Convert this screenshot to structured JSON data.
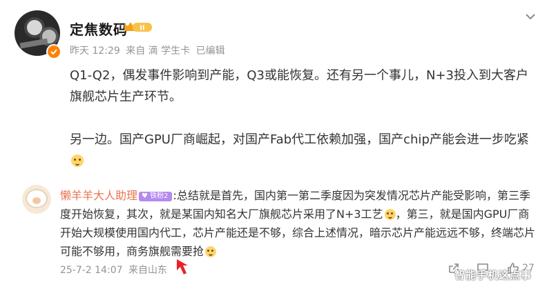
{
  "post": {
    "author": "定焦数码",
    "vip_label": "II",
    "meta": {
      "time": "昨天 12:29",
      "source": "来自 滴 学生卡",
      "edited": "已编辑"
    },
    "paragraphs": [
      "Q1-Q2，偶发事件影响到产能，Q3或能恢复。还有另一个事儿，N+3投入到大客户旗舰芯片生产环节。",
      "另一边。国产GPU厂商崛起，对国产Fab代工依赖加强，国产chip产能会进一步吃紧"
    ],
    "emoji_name": "doge-emoji"
  },
  "comment": {
    "author": "懒羊羊大人助理",
    "fan_badge": "铁粉2",
    "text_part1": ":总结就是首先，国内第一第二季度因为突发情况芯片产能受影响，第三季度开始恢复，其次，就是某国内知名大厂旗舰芯片采用了N+3工艺",
    "text_part2": "，第三，就是国内GPU厂商开始大规模使用国内代工，芯片产能还是不够，综合上述情况，暗示芯片产能远远不够，终端芯片可能不够用，商务旗舰需要抢",
    "date": "25-7-2 14:07",
    "location": "来自山东",
    "like_count": "27"
  },
  "watermark": "智能手机这点事",
  "colors": {
    "accent_orange": "#ff8200",
    "comment_name": "#eb7350",
    "fan_badge": "#b48aef",
    "meta_gray": "#939393",
    "arrow_red": "#e8202a"
  }
}
